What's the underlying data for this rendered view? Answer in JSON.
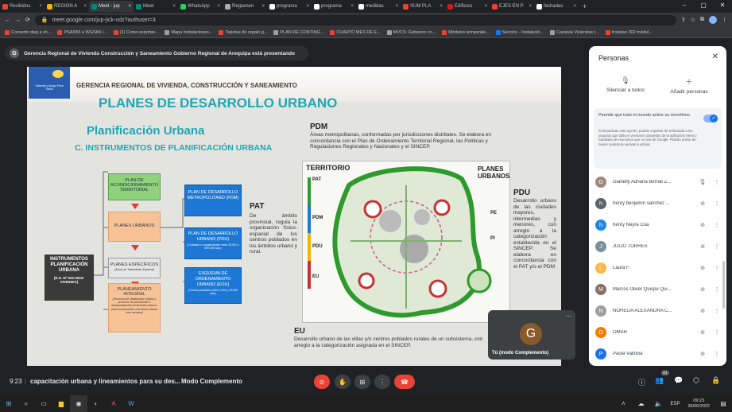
{
  "browser": {
    "tabs": [
      {
        "label": "Recibidos",
        "color": "#ea4335"
      },
      {
        "label": "REGION A",
        "color": "#f4b400"
      },
      {
        "label": "Meet - jup",
        "color": "#00897b"
      },
      {
        "label": "Meet",
        "color": "#00897b"
      },
      {
        "label": "WhatsApp",
        "color": "#25d366"
      },
      {
        "label": "Reglamen",
        "color": "#aaaaaa"
      },
      {
        "label": "programa",
        "color": "#ffffff"
      },
      {
        "label": "programa",
        "color": "#ffffff"
      },
      {
        "label": "medidas",
        "color": "#ffffff"
      },
      {
        "label": "SUM PLA",
        "color": "#ea4335"
      },
      {
        "label": "Edificios",
        "color": "#c5221f"
      },
      {
        "label": "EJES EN P",
        "color": "#ea4335"
      },
      {
        "label": "fachadas",
        "color": "#ffffff"
      }
    ],
    "new_tab": "+",
    "url": "meet.google.com/jup-jick-ndz?authuser=3",
    "bookmarks": [
      {
        "label": "Convertir dwg a sh...",
        "color": "#ea4335"
      },
      {
        "label": "PSAD56 a WGS84 /...",
        "color": "#ea4335"
      },
      {
        "label": "(2) Como exportar...",
        "color": "#ea4335"
      },
      {
        "label": "Mapa Instalaciones...",
        "color": "#9aa0a6"
      },
      {
        "label": "Tarjetas de regalo g...",
        "color": "#ea4335"
      },
      {
        "label": "PLAN DE CONTING...",
        "color": "#9aa0a6"
      },
      {
        "label": "CUARTO MES DE E...",
        "color": "#ea4335"
      },
      {
        "label": "MVCS: Gobierno co...",
        "color": "#9aa0a6"
      },
      {
        "label": "Módulos temporale...",
        "color": "#ea4335"
      },
      {
        "label": "Sencico - Instalació...",
        "color": "#1877f2"
      },
      {
        "label": "Caratula Viviendas t...",
        "color": "#9aa0a6"
      },
      {
        "label": "Instalan 302 módul...",
        "color": "#ea4335"
      }
    ]
  },
  "meet": {
    "presenting_banner": "Gerencia Regional de Vivienda Construcción y Saneamiento Gobierno Regional de Arequipa está presentando",
    "presenter_initial": "G",
    "time": "9:23",
    "meeting_name": "capacitación urbana y lineamientos para su des...",
    "mode": "Modo Complemento",
    "participant_count": "21",
    "self_tile_label": "Tú (modo Complemento)",
    "self_initial": "G"
  },
  "slide": {
    "header": "GERENCIA REGIONAL DE VIVIENDA, CONSTRUCCIÓN Y SANEAMIENTO",
    "logo_text": "Vivienda y Apoyo Para Todos",
    "title": "PLANES DE DESARROLLO URBANO",
    "subtitle1": "Planificación Urbana",
    "subtitle2": "C. INSTRUMENTOS DE PLANIFICACIÓN URBANA",
    "instrumentos_box": "INSTRUMENTOS PLANIFICACIÓN URBANA",
    "instrumentos_sub": "(D.S. Nº 022-2016-VIVIENDA)",
    "plan_acond": "PLAN DE ACONDICIONAMIENTO TERRITORIAL",
    "planes_urbanos": "PLANES URBANOS",
    "planes_especificos": "PLANES ESPECÍFICOS",
    "planes_especificos_sub": "(Áreas de Tratamiento Especial)",
    "planeamiento_integral": "PLANEAMIENTO INTEGRAL",
    "planeamiento_integral_sub": "(Procesos de Habilitación Urbana y procesos de parcelación e independización de terrenos rústicos para incorporación a la trama urbana mas cercana)",
    "pdm_box": "PLAN DE DESARROLLO METROPOLITANO (PDM)",
    "pdu_box": "PLAN DE DESARROLLO URBANO (PDU)",
    "pdu_box_sub": "(Ciudades o conglomerado entre 20,001 y 500,000 hab.)",
    "eou_box": "ESQUEMA DE ORDENAMIENTO URBANO (EOU)",
    "eou_box_sub": "(Centros poblados entre 2,501 y 20,000 hab.)",
    "pat_title": "PAT",
    "pat_text": "De ámbito provincial, regula la organización físico-espacial de los centros poblados en los ámbitos urbano y rural.",
    "pdm_title": "PDM",
    "pdm_text": "Áreas metropolitanas, conformadas por jurisdicciones distritales. Se elabora en concordancia con el Plan de Ordenamiento Territorial Regional, las Políticas y Regulaciones Regionales y Nacionales y el SINCEP.",
    "map_territorio": "TERRITORIO",
    "map_planes_urbanos": "PLANES URBANOS",
    "map_labels": [
      "PAT",
      "PDM",
      "PDU",
      "EU",
      "PE",
      "PI"
    ],
    "pdu_title": "PDU",
    "pdu_text": "Desarrollo urbano de las ciudades mayores, intermedias y menores, con arreglo a la categorización establecida en el SINCEP. Se elabora en concordancia con el PAT y/o el PDM",
    "eu_title": "EU",
    "eu_text": "Desarrollo urbano de las villas y/o centros poblados rurales de un subsistema, con arreglo a la categorización asignada en el SINCEP."
  },
  "people_panel": {
    "title": "Personas",
    "mute_all": "Silenciar a todos",
    "add_people": "Añadir personas",
    "permit_title": "Permitir que todo el mundo active su micrófono",
    "permit_desc": "Si desactivas esta opción, podrás expulsar de la llamada a los usuarios que utilicen versiones obsoletas de la aplicación Meet o hardware de reuniones que no sea de Google. Podrán unirse de nuevo cuando la vuelvas a activar.",
    "participants": [
      {
        "name": "Gianelly Adriana Bernal Z...",
        "initial": "G",
        "color": "#a1887f"
      },
      {
        "name": "henry benjamin sanchez ...",
        "initial": "h",
        "color": "#5f6368"
      },
      {
        "name": "henry Neyra Coa",
        "initial": "h",
        "color": "#1e88e5"
      },
      {
        "name": "JULIO TORRES",
        "initial": "J",
        "color": "#78909c"
      },
      {
        "name": "Laura F.",
        "initial": "L",
        "color": "#ffb74d"
      },
      {
        "name": "Marcos Oliver Quispe Qui...",
        "initial": "M",
        "color": "#8d6e63"
      },
      {
        "name": "NOHELIA ALEXANDRA C...",
        "initial": "N",
        "color": "#9e9e9e"
      },
      {
        "name": "OMAR",
        "initial": "O",
        "color": "#f57c00"
      },
      {
        "name": "Paola Valdivia",
        "initial": "P",
        "color": "#1a73e8"
      }
    ]
  },
  "taskbar": {
    "lang": "ESP",
    "time": "09:23",
    "date": "30/06/2022"
  }
}
